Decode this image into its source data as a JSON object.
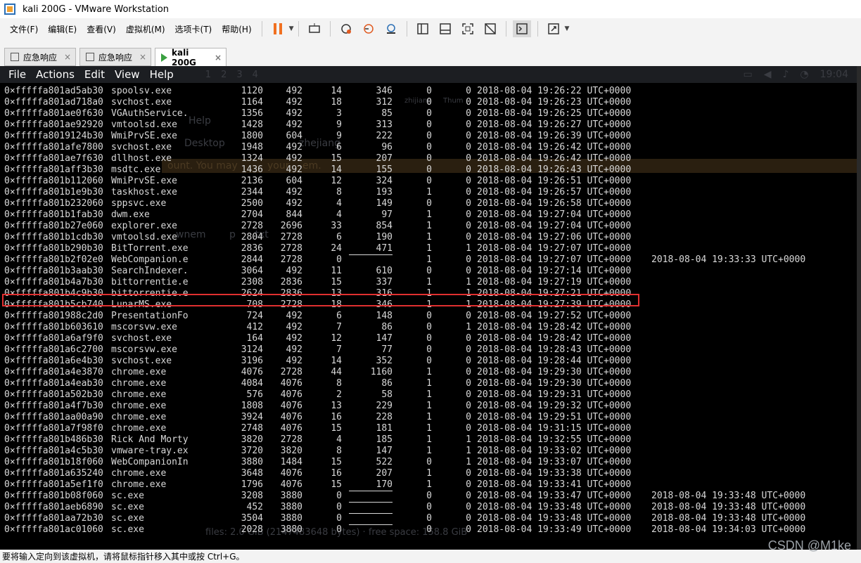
{
  "window": {
    "title": "kali 200G - VMware Workstation"
  },
  "menu": [
    "文件(F)",
    "编辑(E)",
    "查看(V)",
    "虚拟机(M)",
    "选项卡(T)",
    "帮助(H)"
  ],
  "tabs": [
    {
      "label": "应急响应",
      "close": "×"
    },
    {
      "label": "应急响应",
      "close": "×"
    },
    {
      "label": "kali 200G",
      "close": "×"
    }
  ],
  "vm_menu": [
    "File",
    "Actions",
    "Edit",
    "View",
    "Help"
  ],
  "ghost": {
    "workspaces": [
      "1",
      "2",
      "3",
      "4"
    ],
    "clock": "19:04",
    "help": "Help",
    "desktop": "Desktop",
    "account_msg": "ount. You may",
    "account_msg2": "your",
    "account_msg3": "em.",
    "user1": "zhijiang",
    "user2": "zhejiang",
    "file1": "wnem",
    "file2": "p",
    "file3": ".txt",
    "tray": "Thum",
    "disk": "files: 2.0 GiB (2147483648 bytes) · free space: 158.8 GiB"
  },
  "processes": [
    {
      "offset": "0×fffffa801ad5ab30",
      "name": "spoolsv.exe",
      "pid": "1120",
      "ppid": "492",
      "thds": "14",
      "hnds": "346",
      "sess": "0",
      "wow64": "0",
      "start": "2018-08-04 19:26:22 UTC+0000",
      "exit": ""
    },
    {
      "offset": "0×fffffa801ad718a0",
      "name": "svchost.exe",
      "pid": "1164",
      "ppid": "492",
      "thds": "18",
      "hnds": "312",
      "sess": "0",
      "wow64": "0",
      "start": "2018-08-04 19:26:23 UTC+0000",
      "exit": ""
    },
    {
      "offset": "0×fffffa801ae0f630",
      "name": "VGAuthService.",
      "pid": "1356",
      "ppid": "492",
      "thds": "3",
      "hnds": "85",
      "sess": "0",
      "wow64": "0",
      "start": "2018-08-04 19:26:25 UTC+0000",
      "exit": ""
    },
    {
      "offset": "0×fffffa801ae92920",
      "name": "vmtoolsd.exe",
      "pid": "1428",
      "ppid": "492",
      "thds": "9",
      "hnds": "313",
      "sess": "0",
      "wow64": "0",
      "start": "2018-08-04 19:26:27 UTC+0000",
      "exit": ""
    },
    {
      "offset": "0×fffffa8019124b30",
      "name": "WmiPrvSE.exe",
      "pid": "1800",
      "ppid": "604",
      "thds": "9",
      "hnds": "222",
      "sess": "0",
      "wow64": "0",
      "start": "2018-08-04 19:26:39 UTC+0000",
      "exit": ""
    },
    {
      "offset": "0×fffffa801afe7800",
      "name": "svchost.exe",
      "pid": "1948",
      "ppid": "492",
      "thds": "6",
      "hnds": "96",
      "sess": "0",
      "wow64": "0",
      "start": "2018-08-04 19:26:42 UTC+0000",
      "exit": ""
    },
    {
      "offset": "0×fffffa801ae7f630",
      "name": "dllhost.exe",
      "pid": "1324",
      "ppid": "492",
      "thds": "15",
      "hnds": "207",
      "sess": "0",
      "wow64": "0",
      "start": "2018-08-04 19:26:42 UTC+0000",
      "exit": ""
    },
    {
      "offset": "0×fffffa801aff3b30",
      "name": "msdtc.exe",
      "pid": "1436",
      "ppid": "492",
      "thds": "14",
      "hnds": "155",
      "sess": "0",
      "wow64": "0",
      "start": "2018-08-04 19:26:43 UTC+0000",
      "exit": ""
    },
    {
      "offset": "0×fffffa801b112060",
      "name": "WmiPrvSE.exe",
      "pid": "2136",
      "ppid": "604",
      "thds": "12",
      "hnds": "324",
      "sess": "0",
      "wow64": "0",
      "start": "2018-08-04 19:26:51 UTC+0000",
      "exit": ""
    },
    {
      "offset": "0×fffffa801b1e9b30",
      "name": "taskhost.exe",
      "pid": "2344",
      "ppid": "492",
      "thds": "8",
      "hnds": "193",
      "sess": "1",
      "wow64": "0",
      "start": "2018-08-04 19:26:57 UTC+0000",
      "exit": ""
    },
    {
      "offset": "0×fffffa801b232060",
      "name": "sppsvc.exe",
      "pid": "2500",
      "ppid": "492",
      "thds": "4",
      "hnds": "149",
      "sess": "0",
      "wow64": "0",
      "start": "2018-08-04 19:26:58 UTC+0000",
      "exit": ""
    },
    {
      "offset": "0×fffffa801b1fab30",
      "name": "dwm.exe",
      "pid": "2704",
      "ppid": "844",
      "thds": "4",
      "hnds": "97",
      "sess": "1",
      "wow64": "0",
      "start": "2018-08-04 19:27:04 UTC+0000",
      "exit": ""
    },
    {
      "offset": "0×fffffa801b27e060",
      "name": "explorer.exe",
      "pid": "2728",
      "ppid": "2696",
      "thds": "33",
      "hnds": "854",
      "sess": "1",
      "wow64": "0",
      "start": "2018-08-04 19:27:04 UTC+0000",
      "exit": ""
    },
    {
      "offset": "0×fffffa801b1cdb30",
      "name": "vmtoolsd.exe",
      "pid": "2804",
      "ppid": "2728",
      "thds": "6",
      "hnds": "190",
      "sess": "1",
      "wow64": "0",
      "start": "2018-08-04 19:27:06 UTC+0000",
      "exit": ""
    },
    {
      "offset": "0×fffffa801b290b30",
      "name": "BitTorrent.exe",
      "pid": "2836",
      "ppid": "2728",
      "thds": "24",
      "hnds": "471",
      "sess": "1",
      "wow64": "1",
      "start": "2018-08-04 19:27:07 UTC+0000",
      "exit": ""
    },
    {
      "offset": "0×fffffa801b2f02e0",
      "name": "WebCompanion.e",
      "pid": "2844",
      "ppid": "2728",
      "thds": "0",
      "hnds": "-",
      "sess": "1",
      "wow64": "0",
      "start": "2018-08-04 19:27:07 UTC+0000",
      "exit": "2018-08-04 19:33:33 UTC+0000"
    },
    {
      "offset": "0×fffffa801b3aab30",
      "name": "SearchIndexer.",
      "pid": "3064",
      "ppid": "492",
      "thds": "11",
      "hnds": "610",
      "sess": "0",
      "wow64": "0",
      "start": "2018-08-04 19:27:14 UTC+0000",
      "exit": ""
    },
    {
      "offset": "0×fffffa801b4a7b30",
      "name": "bittorrentie.e",
      "pid": "2308",
      "ppid": "2836",
      "thds": "15",
      "hnds": "337",
      "sess": "1",
      "wow64": "1",
      "start": "2018-08-04 19:27:19 UTC+0000",
      "exit": ""
    },
    {
      "offset": "0×fffffa801b4c9b30",
      "name": "bittorrentie.e",
      "pid": "2624",
      "ppid": "2836",
      "thds": "13",
      "hnds": "316",
      "sess": "1",
      "wow64": "1",
      "start": "2018-08-04 19:27:21 UTC+0000",
      "exit": ""
    },
    {
      "offset": "0×fffffa801b5cb740",
      "name": "LunarMS.exe",
      "pid": "708",
      "ppid": "2728",
      "thds": "18",
      "hnds": "346",
      "sess": "1",
      "wow64": "1",
      "start": "2018-08-04 19:27:39 UTC+0000",
      "exit": ""
    },
    {
      "offset": "0×fffffa801988c2d0",
      "name": "PresentationFo",
      "pid": "724",
      "ppid": "492",
      "thds": "6",
      "hnds": "148",
      "sess": "0",
      "wow64": "0",
      "start": "2018-08-04 19:27:52 UTC+0000",
      "exit": ""
    },
    {
      "offset": "0×fffffa801b603610",
      "name": "mscorsvw.exe",
      "pid": "412",
      "ppid": "492",
      "thds": "7",
      "hnds": "86",
      "sess": "0",
      "wow64": "1",
      "start": "2018-08-04 19:28:42 UTC+0000",
      "exit": ""
    },
    {
      "offset": "0×fffffa801a6af9f0",
      "name": "svchost.exe",
      "pid": "164",
      "ppid": "492",
      "thds": "12",
      "hnds": "147",
      "sess": "0",
      "wow64": "0",
      "start": "2018-08-04 19:28:42 UTC+0000",
      "exit": ""
    },
    {
      "offset": "0×fffffa801a6c2700",
      "name": "mscorsvw.exe",
      "pid": "3124",
      "ppid": "492",
      "thds": "7",
      "hnds": "77",
      "sess": "0",
      "wow64": "0",
      "start": "2018-08-04 19:28:43 UTC+0000",
      "exit": ""
    },
    {
      "offset": "0×fffffa801a6e4b30",
      "name": "svchost.exe",
      "pid": "3196",
      "ppid": "492",
      "thds": "14",
      "hnds": "352",
      "sess": "0",
      "wow64": "0",
      "start": "2018-08-04 19:28:44 UTC+0000",
      "exit": ""
    },
    {
      "offset": "0×fffffa801a4e3870",
      "name": "chrome.exe",
      "pid": "4076",
      "ppid": "2728",
      "thds": "44",
      "hnds": "1160",
      "sess": "1",
      "wow64": "0",
      "start": "2018-08-04 19:29:30 UTC+0000",
      "exit": ""
    },
    {
      "offset": "0×fffffa801a4eab30",
      "name": "chrome.exe",
      "pid": "4084",
      "ppid": "4076",
      "thds": "8",
      "hnds": "86",
      "sess": "1",
      "wow64": "0",
      "start": "2018-08-04 19:29:30 UTC+0000",
      "exit": ""
    },
    {
      "offset": "0×fffffa801a502b30",
      "name": "chrome.exe",
      "pid": "576",
      "ppid": "4076",
      "thds": "2",
      "hnds": "58",
      "sess": "1",
      "wow64": "0",
      "start": "2018-08-04 19:29:31 UTC+0000",
      "exit": ""
    },
    {
      "offset": "0×fffffa801a4f7b30",
      "name": "chrome.exe",
      "pid": "1808",
      "ppid": "4076",
      "thds": "13",
      "hnds": "229",
      "sess": "1",
      "wow64": "0",
      "start": "2018-08-04 19:29:32 UTC+0000",
      "exit": ""
    },
    {
      "offset": "0×fffffa801aa00a90",
      "name": "chrome.exe",
      "pid": "3924",
      "ppid": "4076",
      "thds": "16",
      "hnds": "228",
      "sess": "1",
      "wow64": "0",
      "start": "2018-08-04 19:29:51 UTC+0000",
      "exit": ""
    },
    {
      "offset": "0×fffffa801a7f98f0",
      "name": "chrome.exe",
      "pid": "2748",
      "ppid": "4076",
      "thds": "15",
      "hnds": "181",
      "sess": "1",
      "wow64": "0",
      "start": "2018-08-04 19:31:15 UTC+0000",
      "exit": ""
    },
    {
      "offset": "0×fffffa801b486b30",
      "name": "Rick And Morty",
      "pid": "3820",
      "ppid": "2728",
      "thds": "4",
      "hnds": "185",
      "sess": "1",
      "wow64": "1",
      "start": "2018-08-04 19:32:55 UTC+0000",
      "exit": ""
    },
    {
      "offset": "0×fffffa801a4c5b30",
      "name": "vmware-tray.ex",
      "pid": "3720",
      "ppid": "3820",
      "thds": "8",
      "hnds": "147",
      "sess": "1",
      "wow64": "1",
      "start": "2018-08-04 19:33:02 UTC+0000",
      "exit": ""
    },
    {
      "offset": "0×fffffa801b18f060",
      "name": "WebCompanionIn",
      "pid": "3880",
      "ppid": "1484",
      "thds": "15",
      "hnds": "522",
      "sess": "0",
      "wow64": "1",
      "start": "2018-08-04 19:33:07 UTC+0000",
      "exit": ""
    },
    {
      "offset": "0×fffffa801a635240",
      "name": "chrome.exe",
      "pid": "3648",
      "ppid": "4076",
      "thds": "16",
      "hnds": "207",
      "sess": "1",
      "wow64": "0",
      "start": "2018-08-04 19:33:38 UTC+0000",
      "exit": ""
    },
    {
      "offset": "0×fffffa801a5ef1f0",
      "name": "chrome.exe",
      "pid": "1796",
      "ppid": "4076",
      "thds": "15",
      "hnds": "170",
      "sess": "1",
      "wow64": "0",
      "start": "2018-08-04 19:33:41 UTC+0000",
      "exit": ""
    },
    {
      "offset": "0×fffffa801b08f060",
      "name": "sc.exe",
      "pid": "3208",
      "ppid": "3880",
      "thds": "0",
      "hnds": "-",
      "sess": "0",
      "wow64": "0",
      "start": "2018-08-04 19:33:47 UTC+0000",
      "exit": "2018-08-04 19:33:48 UTC+0000"
    },
    {
      "offset": "0×fffffa801aeb6890",
      "name": "sc.exe",
      "pid": "452",
      "ppid": "3880",
      "thds": "0",
      "hnds": "-",
      "sess": "0",
      "wow64": "0",
      "start": "2018-08-04 19:33:48 UTC+0000",
      "exit": "2018-08-04 19:33:48 UTC+0000"
    },
    {
      "offset": "0×fffffa801aa72b30",
      "name": "sc.exe",
      "pid": "3504",
      "ppid": "3880",
      "thds": "0",
      "hnds": "-",
      "sess": "0",
      "wow64": "0",
      "start": "2018-08-04 19:33:48 UTC+0000",
      "exit": "2018-08-04 19:33:48 UTC+0000"
    },
    {
      "offset": "0×fffffa801ac01060",
      "name": "sc.exe",
      "pid": "2028",
      "ppid": "3880",
      "thds": "0",
      "hnds": "-",
      "sess": "0",
      "wow64": "0",
      "start": "2018-08-04 19:33:49 UTC+0000",
      "exit": "2018-08-04 19:34:03 UTC+0000"
    }
  ],
  "highlight_name": "LunarMS.exe",
  "highlight_color": "#e03030",
  "status": "要将输入定向到该虚拟机，请将鼠标指针移入其中或按 Ctrl+G。",
  "watermark": "CSDN @M1ke"
}
